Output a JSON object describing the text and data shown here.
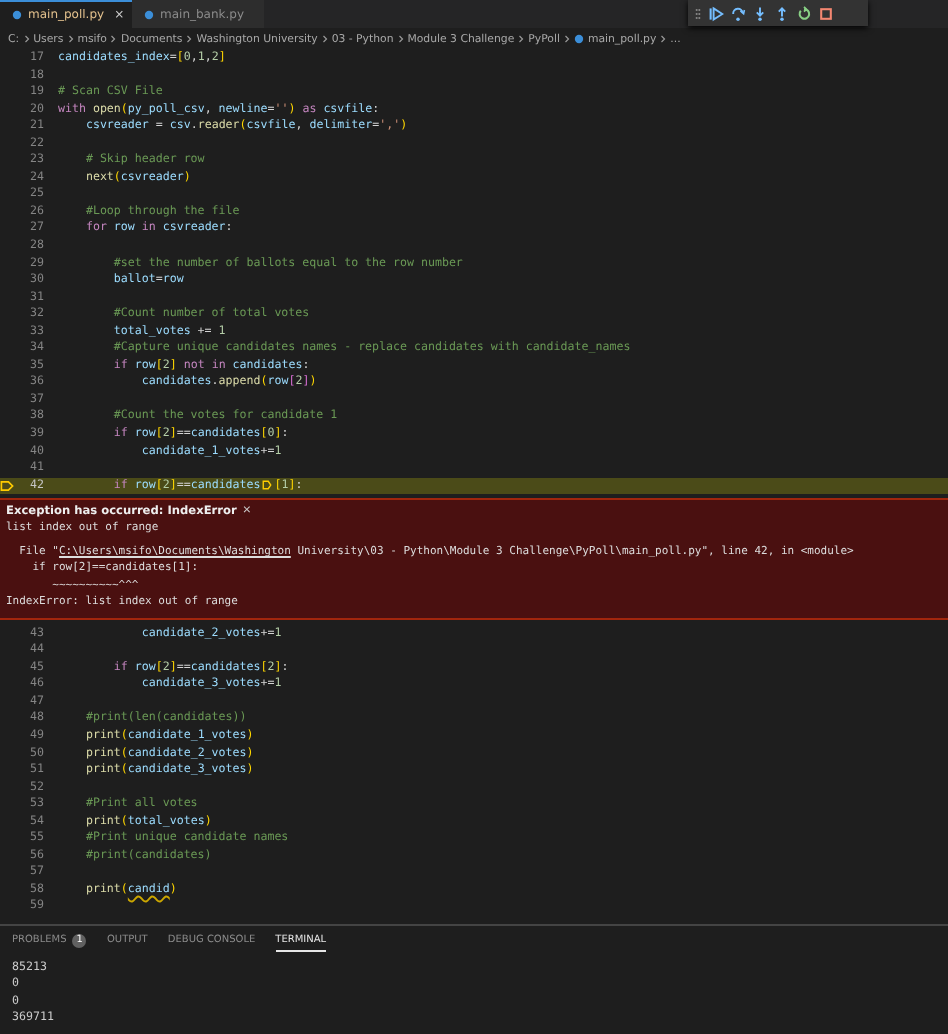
{
  "tabs": [
    {
      "label": "main_poll.py",
      "selected": true,
      "close": "×"
    },
    {
      "label": "main_bank.py",
      "selected": false
    }
  ],
  "breadcrumb": [
    "C:",
    "Users",
    "msifo",
    "Documents",
    "Washington University",
    "03 - Python",
    "Module 3 Challenge",
    "PyPoll",
    "main_poll.py",
    "..."
  ],
  "code_before": [
    {
      "number": "17",
      "current": false,
      "segments": [
        {
          "text": "candidates_index",
          "kind": "v"
        },
        {
          "text": "=",
          "kind": "p"
        },
        {
          "text": "[",
          "kind": "b1"
        },
        {
          "text": "0",
          "kind": "n"
        },
        {
          "text": ",",
          "kind": "p"
        },
        {
          "text": "1",
          "kind": "n"
        },
        {
          "text": ",",
          "kind": "p"
        },
        {
          "text": "2",
          "kind": "n"
        },
        {
          "text": "]",
          "kind": "b1"
        }
      ]
    },
    {
      "number": "18",
      "current": false
    },
    {
      "number": "19",
      "current": false,
      "segments": [
        {
          "text": "# Scan CSV File",
          "kind": "c"
        }
      ]
    },
    {
      "number": "20",
      "current": false,
      "segments": [
        {
          "text": "with ",
          "kind": "k"
        },
        {
          "text": "open",
          "kind": "f"
        },
        {
          "text": "(",
          "kind": "b1"
        },
        {
          "text": "py_poll_csv",
          "kind": "v"
        },
        {
          "text": ", ",
          "kind": "p"
        },
        {
          "text": "newline",
          "kind": "v"
        },
        {
          "text": "=",
          "kind": "p"
        },
        {
          "text": "''",
          "kind": "s"
        },
        {
          "text": ")",
          "kind": "b1"
        },
        {
          "text": " as ",
          "kind": "k"
        },
        {
          "text": "csvfile",
          "kind": "v"
        },
        {
          "text": ":",
          "kind": "p"
        }
      ]
    },
    {
      "number": "21",
      "current": false,
      "segments": [
        {
          "text": "    csvreader",
          "kind": "v"
        },
        {
          "text": " = ",
          "kind": "p"
        },
        {
          "text": "csv",
          "kind": "v"
        },
        {
          "text": ".",
          "kind": "p"
        },
        {
          "text": "reader",
          "kind": "f"
        },
        {
          "text": "(",
          "kind": "b1"
        },
        {
          "text": "csvfile",
          "kind": "v"
        },
        {
          "text": ", ",
          "kind": "p"
        },
        {
          "text": "delimiter",
          "kind": "v"
        },
        {
          "text": "=",
          "kind": "p"
        },
        {
          "text": "','",
          "kind": "s"
        },
        {
          "text": ")",
          "kind": "b1"
        }
      ]
    },
    {
      "number": "22",
      "current": false
    },
    {
      "number": "23",
      "current": false,
      "segments": [
        {
          "text": "    # Skip header row",
          "kind": "c"
        }
      ]
    },
    {
      "number": "24",
      "current": false,
      "segments": [
        {
          "text": "    next",
          "kind": "f"
        },
        {
          "text": "(",
          "kind": "b1"
        },
        {
          "text": "csvreader",
          "kind": "v"
        },
        {
          "text": ")",
          "kind": "b1"
        }
      ]
    },
    {
      "number": "25",
      "current": false
    },
    {
      "number": "26",
      "current": false,
      "segments": [
        {
          "text": "    #Loop through the file",
          "kind": "c"
        }
      ]
    },
    {
      "number": "27",
      "current": false,
      "segments": [
        {
          "text": "    for ",
          "kind": "k"
        },
        {
          "text": "row",
          "kind": "v"
        },
        {
          "text": " in ",
          "kind": "k"
        },
        {
          "text": "csvreader",
          "kind": "v"
        },
        {
          "text": ":",
          "kind": "p"
        }
      ]
    },
    {
      "number": "28",
      "current": false
    },
    {
      "number": "29",
      "current": false,
      "segments": [
        {
          "text": "        #set the number of ballots equal to the row number",
          "kind": "c"
        }
      ]
    },
    {
      "number": "30",
      "current": false,
      "segments": [
        {
          "text": "        ballot",
          "kind": "v"
        },
        {
          "text": "=",
          "kind": "p"
        },
        {
          "text": "row",
          "kind": "v"
        }
      ]
    },
    {
      "number": "31",
      "current": false
    },
    {
      "number": "32",
      "current": false,
      "segments": [
        {
          "text": "        #Count number of total votes",
          "kind": "c"
        }
      ]
    },
    {
      "number": "33",
      "current": false,
      "segments": [
        {
          "text": "        total_votes",
          "kind": "v"
        },
        {
          "text": " += ",
          "kind": "p"
        },
        {
          "text": "1",
          "kind": "n"
        }
      ]
    },
    {
      "number": "34",
      "current": false,
      "segments": [
        {
          "text": "        #Capture unique candidates names - replace candidates with candidate_names",
          "kind": "c"
        }
      ]
    },
    {
      "number": "35",
      "current": false,
      "segments": [
        {
          "text": "        if ",
          "kind": "k"
        },
        {
          "text": "row",
          "kind": "v"
        },
        {
          "text": "[",
          "kind": "b1"
        },
        {
          "text": "2",
          "kind": "n"
        },
        {
          "text": "]",
          "kind": "b1"
        },
        {
          "text": " not in ",
          "kind": "k"
        },
        {
          "text": "candidates",
          "kind": "v"
        },
        {
          "text": ":",
          "kind": "p"
        }
      ]
    },
    {
      "number": "36",
      "current": false,
      "segments": [
        {
          "text": "            candidates",
          "kind": "v"
        },
        {
          "text": ".",
          "kind": "p"
        },
        {
          "text": "append",
          "kind": "f"
        },
        {
          "text": "(",
          "kind": "b1"
        },
        {
          "text": "row",
          "kind": "v"
        },
        {
          "text": "[",
          "kind": "b2"
        },
        {
          "text": "2",
          "kind": "n"
        },
        {
          "text": "]",
          "kind": "b2"
        },
        {
          "text": ")",
          "kind": "b1"
        }
      ]
    },
    {
      "number": "37",
      "current": false
    },
    {
      "number": "38",
      "current": false,
      "segments": [
        {
          "text": "        #Count the votes for candidate 1",
          "kind": "c"
        }
      ]
    },
    {
      "number": "39",
      "current": false,
      "segments": [
        {
          "text": "        if ",
          "kind": "k"
        },
        {
          "text": "row",
          "kind": "v"
        },
        {
          "text": "[",
          "kind": "b1"
        },
        {
          "text": "2",
          "kind": "n"
        },
        {
          "text": "]",
          "kind": "b1"
        },
        {
          "text": "==",
          "kind": "p"
        },
        {
          "text": "candidates",
          "kind": "v"
        },
        {
          "text": "[",
          "kind": "b1"
        },
        {
          "text": "0",
          "kind": "n"
        },
        {
          "text": "]",
          "kind": "b1"
        },
        {
          "text": ":",
          "kind": "p"
        }
      ]
    },
    {
      "number": "40",
      "current": false,
      "segments": [
        {
          "text": "            candidate_1_votes",
          "kind": "v"
        },
        {
          "text": "+=",
          "kind": "p"
        },
        {
          "text": "1",
          "kind": "n"
        }
      ]
    },
    {
      "number": "41",
      "current": false
    },
    {
      "number": "42",
      "current": true,
      "segments": [
        {
          "text": "        if ",
          "kind": "k"
        },
        {
          "text": "row",
          "kind": "v"
        },
        {
          "text": "[",
          "kind": "b1"
        },
        {
          "text": "2",
          "kind": "n"
        },
        {
          "text": "]",
          "kind": "b1"
        },
        {
          "text": "==",
          "kind": "p"
        },
        {
          "text": "candidates",
          "kind": "v"
        }
      ],
      "after_marker": [
        {
          "text": "[",
          "kind": "b1"
        },
        {
          "text": "1",
          "kind": "n"
        },
        {
          "text": "]",
          "kind": "b1"
        },
        {
          "text": ":",
          "kind": "p"
        }
      ]
    }
  ],
  "exception": {
    "title": "Exception has occurred: IndexError",
    "close": "×",
    "message": "list index out of range",
    "file_prefix": "  File \"",
    "file_link": "C:\\Users\\msifo\\Documents\\Washington",
    "file_rest": " University\\03 - Python\\Module 3 Challenge\\PyPoll\\main_poll.py\", line 42, in <module>",
    "source": "    if row[2]==candidates[1]:",
    "caret": "       ~~~~~~~~~~^^^",
    "error": "IndexError: list index out of range"
  },
  "code_after": [
    {
      "number": "43",
      "current": false,
      "segments": [
        {
          "text": "            candidate_2_votes",
          "kind": "v"
        },
        {
          "text": "+=",
          "kind": "p"
        },
        {
          "text": "1",
          "kind": "n"
        }
      ]
    },
    {
      "number": "44",
      "current": false
    },
    {
      "number": "45",
      "current": false,
      "segments": [
        {
          "text": "        if ",
          "kind": "k"
        },
        {
          "text": "row",
          "kind": "v"
        },
        {
          "text": "[",
          "kind": "b1"
        },
        {
          "text": "2",
          "kind": "n"
        },
        {
          "text": "]",
          "kind": "b1"
        },
        {
          "text": "==",
          "kind": "p"
        },
        {
          "text": "candidates",
          "kind": "v"
        },
        {
          "text": "[",
          "kind": "b1"
        },
        {
          "text": "2",
          "kind": "n"
        },
        {
          "text": "]",
          "kind": "b1"
        },
        {
          "text": ":",
          "kind": "p"
        }
      ]
    },
    {
      "number": "46",
      "current": false,
      "segments": [
        {
          "text": "            candidate_3_votes",
          "kind": "v"
        },
        {
          "text": "+=",
          "kind": "p"
        },
        {
          "text": "1",
          "kind": "n"
        }
      ]
    },
    {
      "number": "47",
      "current": false
    },
    {
      "number": "48",
      "current": false,
      "segments": [
        {
          "text": "    #print(len(candidates))",
          "kind": "c"
        }
      ]
    },
    {
      "number": "49",
      "current": false,
      "segments": [
        {
          "text": "    print",
          "kind": "f"
        },
        {
          "text": "(",
          "kind": "b1"
        },
        {
          "text": "candidate_1_votes",
          "kind": "v"
        },
        {
          "text": ")",
          "kind": "b1"
        }
      ]
    },
    {
      "number": "50",
      "current": false,
      "segments": [
        {
          "text": "    print",
          "kind": "f"
        },
        {
          "text": "(",
          "kind": "b1"
        },
        {
          "text": "candidate_2_votes",
          "kind": "v"
        },
        {
          "text": ")",
          "kind": "b1"
        }
      ]
    },
    {
      "number": "51",
      "current": false,
      "segments": [
        {
          "text": "    print",
          "kind": "f"
        },
        {
          "text": "(",
          "kind": "b1"
        },
        {
          "text": "candidate_3_votes",
          "kind": "v"
        },
        {
          "text": ")",
          "kind": "b1"
        }
      ]
    },
    {
      "number": "52",
      "current": false
    },
    {
      "number": "53",
      "current": false,
      "segments": [
        {
          "text": "    #Print all votes",
          "kind": "c"
        }
      ]
    },
    {
      "number": "54",
      "current": false,
      "segments": [
        {
          "text": "    print",
          "kind": "f"
        },
        {
          "text": "(",
          "kind": "b1"
        },
        {
          "text": "total_votes",
          "kind": "v"
        },
        {
          "text": ")",
          "kind": "b1"
        }
      ]
    },
    {
      "number": "55",
      "current": false,
      "segments": [
        {
          "text": "    #Print unique candidate names",
          "kind": "c"
        }
      ]
    },
    {
      "number": "56",
      "current": false,
      "segments": [
        {
          "text": "    #print(candidates)",
          "kind": "c"
        }
      ]
    },
    {
      "number": "57",
      "current": false
    },
    {
      "number": "58",
      "current": false,
      "segments": [
        {
          "text": "    print",
          "kind": "f"
        },
        {
          "text": "(",
          "kind": "b1"
        },
        {
          "text": "candid",
          "kind": "w"
        },
        {
          "text": ")",
          "kind": "b1"
        }
      ]
    },
    {
      "number": "59",
      "current": false
    }
  ],
  "panel_tabs": [
    {
      "label": "PROBLEMS",
      "badge": "1",
      "selected": false
    },
    {
      "label": "OUTPUT",
      "selected": false
    },
    {
      "label": "DEBUG CONSOLE",
      "selected": false
    },
    {
      "label": "TERMINAL",
      "selected": true
    }
  ],
  "terminal": [
    "85213",
    "0",
    "0",
    "369711"
  ]
}
